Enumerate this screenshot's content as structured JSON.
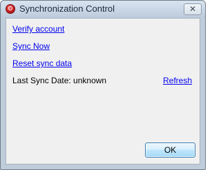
{
  "window": {
    "title": "Synchronization Control",
    "close_glyph": "✕",
    "app_icon": "sync-app-icon"
  },
  "links": {
    "verify_account": "Verify account",
    "sync_now": "Sync Now",
    "reset_sync_data": "Reset sync data",
    "refresh": "Refresh"
  },
  "status": {
    "last_sync_label": "Last Sync Date: unknown"
  },
  "buttons": {
    "ok": "OK"
  },
  "colors": {
    "link": "#0000ee",
    "client_background": "#f0f0f0",
    "frame": "#bfcddb"
  }
}
